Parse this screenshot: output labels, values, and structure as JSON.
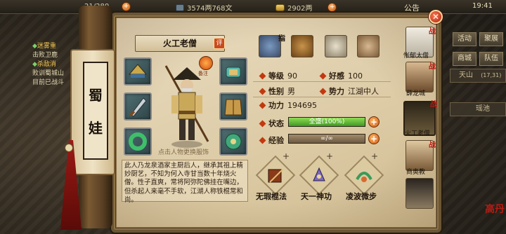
{
  "topbar": {
    "stamina": "21/280",
    "copper": "3574两768文",
    "gold": "2902两",
    "notice": "公告",
    "time": "19:41"
  },
  "quest": {
    "title1": "迷雾重",
    "line1": "击败卫鹿",
    "title2": "杀敌消",
    "line2": "败训蜀城山",
    "line3": "目前已战斗"
  },
  "side_menu": {
    "activity": "活动",
    "friends": "聚展",
    "shop": "商城",
    "team": "队伍",
    "location": "天山",
    "location_coord": "(17,31)",
    "map": "瑶池"
  },
  "scroll": {
    "chars": [
      "蜀",
      "娃"
    ]
  },
  "character": {
    "name": "火工老僧",
    "eval_label": "评",
    "fate_label": "备注",
    "hint": "点击人物更换服饰",
    "level_label": "等级",
    "level": "90",
    "favor_label": "好感",
    "favor": "100",
    "gender_label": "性别",
    "gender": "男",
    "faction_label": "势力",
    "faction": "江湖中人",
    "power_label": "功力",
    "power": "194695",
    "status_label": "状态",
    "status_text": "全盛(100%)",
    "status_pct": 100,
    "exp_label": "经验",
    "exp_text": "∞/∞",
    "exp_pct": 100
  },
  "description": "此人乃龙泉酒家主厨后人，继承其祖上精妙厨艺，不知为何入寺甘当数十年烧火僧。性子直爽，常将阿弥陀佛挂在嘴边，但杀起人来毫不手软，江湖人称铁棍常和尚。",
  "skills": [
    {
      "name": "无瑕棍法"
    },
    {
      "name": "天一神功"
    },
    {
      "name": "凌波微步"
    }
  ],
  "top_icons": {
    "badge": "指"
  },
  "portraits": [
    {
      "name": "怅郁太僧",
      "badge": "战"
    },
    {
      "name": "薛龙城",
      "badge": "战"
    },
    {
      "name": "火工老僧",
      "badge": "战"
    },
    {
      "name": "商奥教",
      "badge": "战"
    }
  ],
  "seal": "高丹",
  "colors": {
    "accent": "#c2380f",
    "bar_green": "#3f9a22",
    "paper": "#e9dcc0"
  }
}
